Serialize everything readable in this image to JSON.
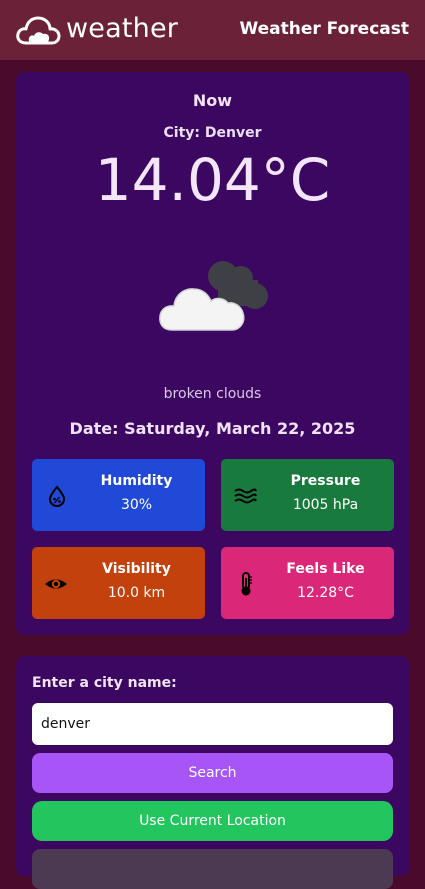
{
  "header": {
    "logo_text": "weather",
    "title": "Weather Forecast",
    "logo_icon": "cloud-icon"
  },
  "current": {
    "now_label": "Now",
    "city": "City: Denver",
    "temperature": "14.04°C",
    "condition_icon": "broken-clouds-icon",
    "description": "broken clouds",
    "date": "Date: Saturday, March 22, 2025"
  },
  "stats": {
    "humidity": {
      "label": "Humidity",
      "value": "30%",
      "icon": "humidity-drop-icon",
      "color": "#1f49d6"
    },
    "pressure": {
      "label": "Pressure",
      "value": "1005 hPa",
      "icon": "wind-waves-icon",
      "color": "#187a3d"
    },
    "visibility": {
      "label": "Visibility",
      "value": "10.0 km",
      "icon": "eye-icon",
      "color": "#c2410c"
    },
    "feels_like": {
      "label": "Feels Like",
      "value": "12.28°C",
      "icon": "thermometer-icon",
      "color": "#db2777"
    }
  },
  "search": {
    "label": "Enter a city name:",
    "input_value": "denver",
    "search_button": "Search",
    "location_button": "Use Current Location"
  },
  "colors": {
    "background": "#4a0a2c",
    "header": "#6b2238",
    "card": "#3c0760",
    "search_button": "#a855f7",
    "location_button": "#22c55e"
  }
}
